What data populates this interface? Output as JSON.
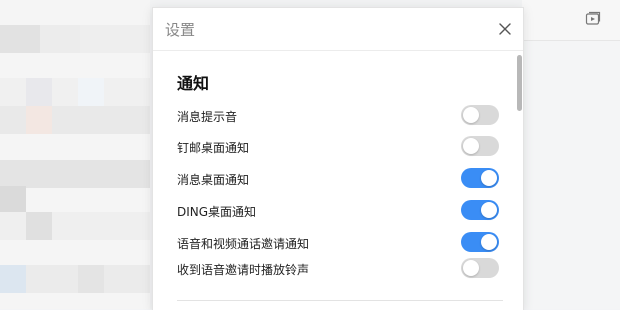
{
  "modal": {
    "title": "设置",
    "close_icon": "close-icon"
  },
  "notifications": {
    "section_title": "通知",
    "items": [
      {
        "label": "消息提示音",
        "enabled": false
      },
      {
        "label": "钉邮桌面通知",
        "enabled": false
      },
      {
        "label": "消息桌面通知",
        "enabled": true
      },
      {
        "label": "DING桌面通知",
        "enabled": true
      },
      {
        "label": "语音和视频通话邀请通知",
        "enabled": true
      },
      {
        "label": "收到语音邀请时播放铃声",
        "enabled": false
      }
    ]
  },
  "colors": {
    "toggle_on": "#3a8df5",
    "toggle_off": "#d9d9d9"
  },
  "background": {
    "top_icon": "video-icon"
  }
}
